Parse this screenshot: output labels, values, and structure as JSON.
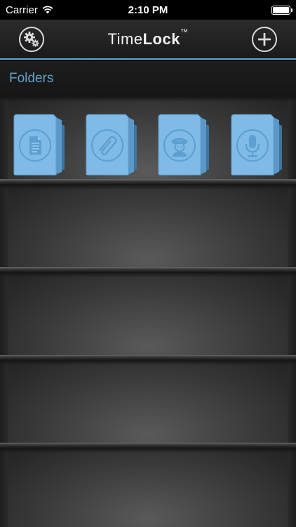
{
  "status_bar": {
    "carrier": "Carrier",
    "time": "2:10 PM",
    "battery_level": 1.0
  },
  "nav": {
    "title_light": "Time",
    "title_bold": "Lock",
    "title_mark": "™",
    "left_icon": "settings-gears-icon",
    "right_icon": "plus-circle-icon"
  },
  "section": {
    "title": "Folders"
  },
  "folders": [
    {
      "icon": "document-icon"
    },
    {
      "icon": "paperclip-icon"
    },
    {
      "icon": "contact-person-icon"
    },
    {
      "icon": "microphone-icon"
    }
  ],
  "colors": {
    "accent": "#57a9d8",
    "section_title": "#5ba4cc",
    "folder_blue": "#7fbbe6"
  }
}
